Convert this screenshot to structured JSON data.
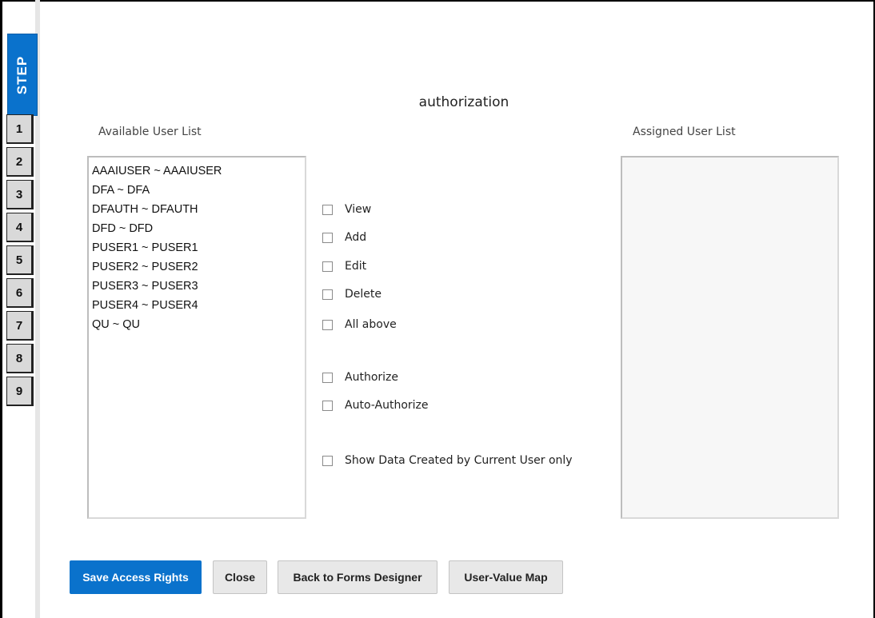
{
  "stepper": {
    "header": "STEP",
    "steps": [
      "1",
      "2",
      "3",
      "4",
      "5",
      "6",
      "7",
      "8",
      "9"
    ]
  },
  "page_title": "authorization",
  "available_list": {
    "label": "Available User List",
    "items": [
      "AAAIUSER ~ AAAIUSER",
      "DFA ~ DFA",
      "DFAUTH ~ DFAUTH",
      "DFD ~ DFD",
      "PUSER1 ~ PUSER1",
      "PUSER2 ~ PUSER2",
      "PUSER3 ~ PUSER3",
      "PUSER4 ~ PUSER4",
      "QU ~ QU"
    ]
  },
  "assigned_list": {
    "label": "Assigned User List",
    "items": []
  },
  "permissions": {
    "view": {
      "label": "View",
      "checked": false
    },
    "add": {
      "label": "Add",
      "checked": false
    },
    "edit": {
      "label": "Edit",
      "checked": false
    },
    "delete": {
      "label": "Delete",
      "checked": false
    },
    "all_above": {
      "label": "All above",
      "checked": false
    },
    "authorize": {
      "label": "Authorize",
      "checked": false
    },
    "auto_authorize": {
      "label": "Auto-Authorize",
      "checked": false
    },
    "show_own_data": {
      "label": "Show Data Created by Current User only",
      "checked": false
    }
  },
  "buttons": {
    "save": "Save Access Rights",
    "close": "Close",
    "back": "Back to Forms Designer",
    "user_value_map": "User-Value Map"
  },
  "colors": {
    "accent": "#0a72cc",
    "button_bg": "#e8e8e8"
  }
}
